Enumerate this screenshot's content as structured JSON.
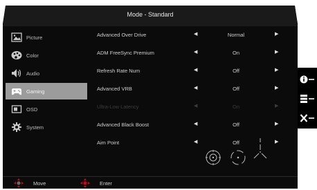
{
  "title": "Mode - Standard",
  "sidebar": {
    "items": [
      {
        "label": "Picture",
        "icon": "picture-icon"
      },
      {
        "label": "Color",
        "icon": "palette-icon"
      },
      {
        "label": "Audio",
        "icon": "speaker-icon"
      },
      {
        "label": "Gaming",
        "icon": "gamepad-icon",
        "active": true
      },
      {
        "label": "OSD",
        "icon": "osd-window-icon"
      },
      {
        "label": "System",
        "icon": "gear-icon"
      }
    ]
  },
  "settings": [
    {
      "name": "Advanced Over Drive",
      "value": "Normal",
      "enabled": true
    },
    {
      "name": "ADM FreeSync Premium",
      "value": "On",
      "enabled": true
    },
    {
      "name": "Refresh Rate Num",
      "value": "Off",
      "enabled": true
    },
    {
      "name": "Advanced VRB",
      "value": "Off",
      "enabled": true
    },
    {
      "name": "Ultra-Low Latency",
      "value": "On",
      "enabled": false
    },
    {
      "name": "Advanced Black Boost",
      "value": "Off",
      "enabled": true
    },
    {
      "name": "Aim Point",
      "value": "Off",
      "enabled": true
    }
  ],
  "aim_point_icons": [
    "aim-point-circle-icon",
    "aim-point-dotted-circle-icon",
    "aim-point-cross-icon"
  ],
  "footer": {
    "move_label": "Move",
    "enter_label": "Enter"
  },
  "side_keys": [
    "info-key-icon",
    "menu-key-icon",
    "close-key-icon"
  ],
  "colors": {
    "background": "#0b0b0b",
    "header": "#1a1a1a",
    "active_item": "#9c9c9c",
    "joystick_red": "#d0021b"
  }
}
